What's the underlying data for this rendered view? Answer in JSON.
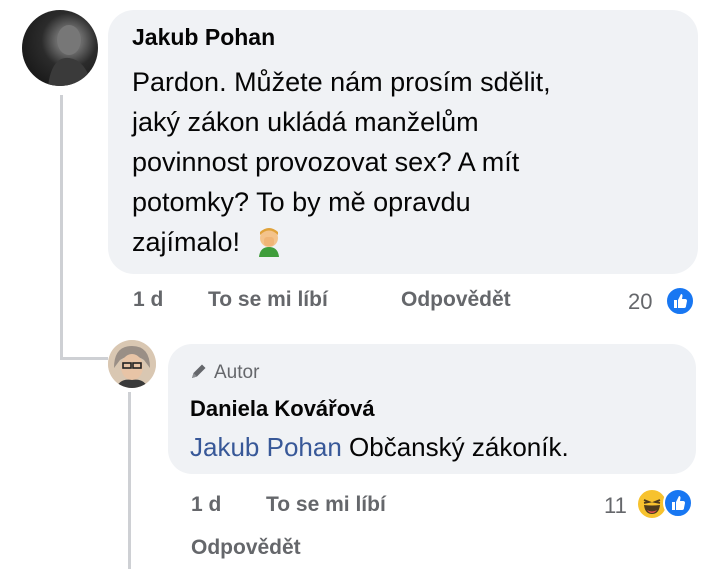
{
  "comment": {
    "author": "Jakub Pohan",
    "text_lines": [
      "Pardon. Můžete nám prosím sdělit,",
      "jaký zákon ukládá manželům",
      "povinnost provozovat sex? A mít",
      "potomky?  To by mě opravdu",
      "zajímalo!"
    ],
    "emoji_icon": "facepalm-emoji",
    "time": "1 d",
    "like_label": "To se mi líbí",
    "reply_label": "Odpovědět",
    "reaction_count": "20",
    "reaction_icon": "like-icon",
    "colors": {
      "bubble": "#f0f2f5",
      "like": "#1877f2"
    }
  },
  "reply": {
    "badge_icon": "pencil-icon",
    "badge_label": "Autor",
    "author": "Daniela Kovářová",
    "mention": "Jakub Pohan",
    "text": "Občanský zákoník.",
    "time": "1 d",
    "like_label": "To se mi líbí",
    "reply_label": "Odpovědět",
    "reaction_count": "11",
    "reaction_icons": [
      "haha-icon",
      "like-icon"
    ],
    "colors": {
      "mention": "#385898"
    }
  }
}
